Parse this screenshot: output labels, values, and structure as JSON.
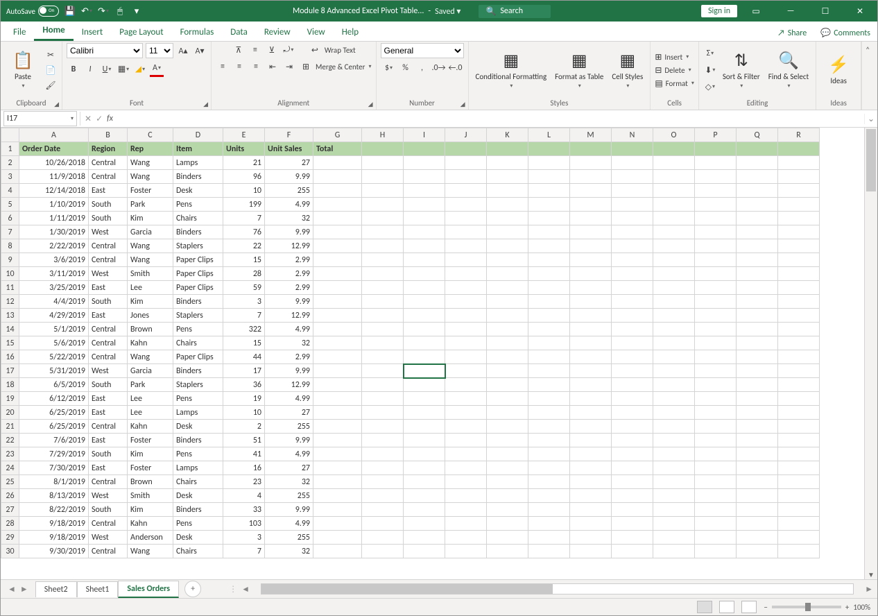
{
  "title": {
    "autosave": "AutoSave",
    "autosave_state": "On",
    "filename": "Module 8 Advanced Excel Pivot Table...",
    "saved": "Saved",
    "search": "Search",
    "signin": "Sign in"
  },
  "tabs": {
    "file": "File",
    "home": "Home",
    "insert": "Insert",
    "pagelayout": "Page Layout",
    "formulas": "Formulas",
    "data": "Data",
    "review": "Review",
    "view": "View",
    "help": "Help",
    "share": "Share",
    "comments": "Comments"
  },
  "ribbon": {
    "clipboard": {
      "label": "Clipboard",
      "paste": "Paste"
    },
    "font": {
      "label": "Font",
      "name": "Calibri",
      "size": "11"
    },
    "alignment": {
      "label": "Alignment",
      "wrap": "Wrap Text",
      "merge": "Merge & Center"
    },
    "number": {
      "label": "Number",
      "format": "General"
    },
    "styles": {
      "label": "Styles",
      "cond": "Conditional Formatting",
      "table": "Format as Table",
      "cell": "Cell Styles"
    },
    "cells": {
      "label": "Cells",
      "insert": "Insert",
      "delete": "Delete",
      "format": "Format"
    },
    "editing": {
      "label": "Editing",
      "sort": "Sort & Filter",
      "find": "Find & Select"
    },
    "ideas": {
      "label": "Ideas",
      "btn": "Ideas"
    }
  },
  "fx": {
    "cell": "I17",
    "formula": ""
  },
  "columns": [
    "A",
    "B",
    "C",
    "D",
    "E",
    "F",
    "G",
    "H",
    "I",
    "J",
    "K",
    "L",
    "M",
    "N",
    "O",
    "P",
    "Q",
    "R"
  ],
  "headers": [
    "Order Date",
    "Region",
    "Rep",
    "Item",
    "Units",
    "Unit Sales",
    "Total"
  ],
  "rows": [
    [
      "10/26/2018",
      "Central",
      "Wang",
      "Lamps",
      "21",
      "27",
      ""
    ],
    [
      "11/9/2018",
      "Central",
      "Wang",
      "Binders",
      "96",
      "9.99",
      ""
    ],
    [
      "12/14/2018",
      "East",
      "Foster",
      "Desk",
      "10",
      "255",
      ""
    ],
    [
      "1/10/2019",
      "South",
      "Park",
      "Pens",
      "199",
      "4.99",
      ""
    ],
    [
      "1/11/2019",
      "South",
      "Kim",
      "Chairs",
      "7",
      "32",
      ""
    ],
    [
      "1/30/2019",
      "West",
      "Garcia",
      "Binders",
      "76",
      "9.99",
      ""
    ],
    [
      "2/22/2019",
      "Central",
      "Wang",
      "Staplers",
      "22",
      "12.99",
      ""
    ],
    [
      "3/6/2019",
      "Central",
      "Wang",
      "Paper Clips",
      "15",
      "2.99",
      ""
    ],
    [
      "3/11/2019",
      "West",
      "Smith",
      "Paper Clips",
      "28",
      "2.99",
      ""
    ],
    [
      "3/25/2019",
      "East",
      "Lee",
      "Paper Clips",
      "59",
      "2.99",
      ""
    ],
    [
      "4/4/2019",
      "South",
      "Kim",
      "Binders",
      "3",
      "9.99",
      ""
    ],
    [
      "4/29/2019",
      "East",
      "Jones",
      "Staplers",
      "7",
      "12.99",
      ""
    ],
    [
      "5/1/2019",
      "Central",
      "Brown",
      "Pens",
      "322",
      "4.99",
      ""
    ],
    [
      "5/6/2019",
      "Central",
      "Kahn",
      "Chairs",
      "15",
      "32",
      ""
    ],
    [
      "5/22/2019",
      "Central",
      "Wang",
      "Paper Clips",
      "44",
      "2.99",
      ""
    ],
    [
      "5/31/2019",
      "West",
      "Garcia",
      "Binders",
      "17",
      "9.99",
      ""
    ],
    [
      "6/5/2019",
      "South",
      "Park",
      "Staplers",
      "36",
      "12.99",
      ""
    ],
    [
      "6/12/2019",
      "East",
      "Lee",
      "Pens",
      "19",
      "4.99",
      ""
    ],
    [
      "6/25/2019",
      "East",
      "Lee",
      "Lamps",
      "10",
      "27",
      ""
    ],
    [
      "6/25/2019",
      "Central",
      "Kahn",
      "Desk",
      "2",
      "255",
      ""
    ],
    [
      "7/6/2019",
      "East",
      "Foster",
      "Binders",
      "51",
      "9.99",
      ""
    ],
    [
      "7/29/2019",
      "South",
      "Kim",
      "Pens",
      "41",
      "4.99",
      ""
    ],
    [
      "7/30/2019",
      "East",
      "Foster",
      "Lamps",
      "16",
      "27",
      ""
    ],
    [
      "8/1/2019",
      "Central",
      "Brown",
      "Chairs",
      "23",
      "32",
      ""
    ],
    [
      "8/13/2019",
      "West",
      "Smith",
      "Desk",
      "4",
      "255",
      ""
    ],
    [
      "8/22/2019",
      "South",
      "Kim",
      "Binders",
      "33",
      "9.99",
      ""
    ],
    [
      "9/18/2019",
      "Central",
      "Kahn",
      "Pens",
      "103",
      "4.99",
      ""
    ],
    [
      "9/18/2019",
      "West",
      "Anderson",
      "Desk",
      "3",
      "255",
      ""
    ],
    [
      "9/30/2019",
      "Central",
      "Wang",
      "Chairs",
      "7",
      "32",
      ""
    ]
  ],
  "sheets": {
    "s1": "Sheet2",
    "s2": "Sheet1",
    "s3": "Sales Orders"
  },
  "status": {
    "zoom": "100%"
  },
  "selected_cell": "I17"
}
